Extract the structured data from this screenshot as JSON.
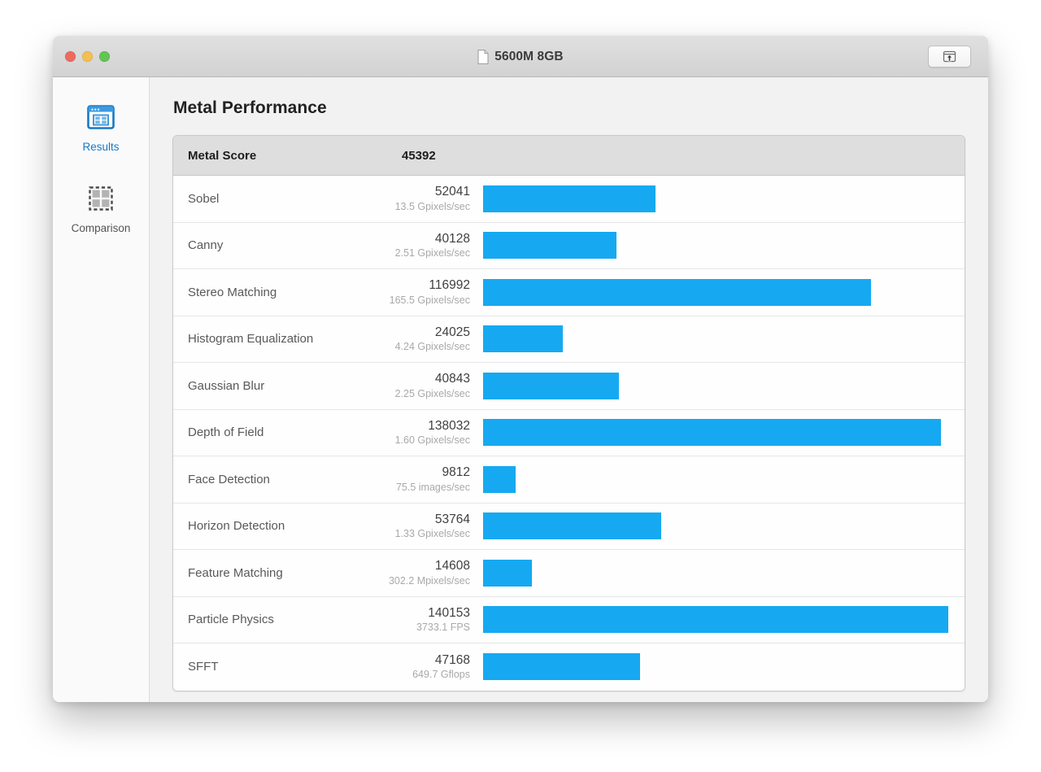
{
  "window": {
    "title": "5600M 8GB",
    "title_icon": "document-icon",
    "traffic_lights": [
      {
        "name": "close-button",
        "color": "#ed6a5e"
      },
      {
        "name": "minimize-button",
        "color": "#f5bf4f"
      },
      {
        "name": "zoom-button",
        "color": "#61c554"
      }
    ],
    "share_button_icon": "share-upload-icon"
  },
  "sidebar": {
    "items": [
      {
        "label": "Results",
        "icon": "results-window-grid-icon",
        "active": true
      },
      {
        "label": "Comparison",
        "icon": "comparison-dashed-grid-icon",
        "active": false
      }
    ]
  },
  "main": {
    "page_title": "Metal Performance",
    "accent_color": "#16a9f1",
    "header": {
      "name": "Metal Score",
      "score": "45392"
    }
  },
  "chart_data": {
    "type": "bar",
    "title": "Metal Performance",
    "xlabel": "",
    "ylabel": "",
    "grid": false,
    "legend": "none",
    "orientation": "horizontal",
    "bar_color": "#16a9f1",
    "overall_score_label": "Metal Score",
    "overall_score": 45392,
    "max_value": 140153,
    "categories": [
      "Sobel",
      "Canny",
      "Stereo Matching",
      "Histogram Equalization",
      "Gaussian Blur",
      "Depth of Field",
      "Face Detection",
      "Horizon Detection",
      "Feature Matching",
      "Particle Physics",
      "SFFT"
    ],
    "values": [
      52041,
      40128,
      116992,
      24025,
      40843,
      138032,
      9812,
      53764,
      14608,
      140153,
      47168
    ],
    "rates": [
      "13.5 Gpixels/sec",
      "2.51 Gpixels/sec",
      "165.5 Gpixels/sec",
      "4.24 Gpixels/sec",
      "2.25 Gpixels/sec",
      "1.60 Gpixels/sec",
      "75.5 images/sec",
      "1.33 Gpixels/sec",
      "302.2 Mpixels/sec",
      "3733.1 FPS",
      "649.7 Gflops"
    ],
    "rows": [
      {
        "name": "Sobel",
        "score": "52041",
        "rate": "13.5 Gpixels/sec",
        "value": 52041
      },
      {
        "name": "Canny",
        "score": "40128",
        "rate": "2.51 Gpixels/sec",
        "value": 40128
      },
      {
        "name": "Stereo Matching",
        "score": "116992",
        "rate": "165.5 Gpixels/sec",
        "value": 116992
      },
      {
        "name": "Histogram Equalization",
        "score": "24025",
        "rate": "4.24 Gpixels/sec",
        "value": 24025
      },
      {
        "name": "Gaussian Blur",
        "score": "40843",
        "rate": "2.25 Gpixels/sec",
        "value": 40843
      },
      {
        "name": "Depth of Field",
        "score": "138032",
        "rate": "1.60 Gpixels/sec",
        "value": 138032
      },
      {
        "name": "Face Detection",
        "score": "9812",
        "rate": "75.5 images/sec",
        "value": 9812
      },
      {
        "name": "Horizon Detection",
        "score": "53764",
        "rate": "1.33 Gpixels/sec",
        "value": 53764
      },
      {
        "name": "Feature Matching",
        "score": "14608",
        "rate": "302.2 Mpixels/sec",
        "value": 14608
      },
      {
        "name": "Particle Physics",
        "score": "140153",
        "rate": "3733.1 FPS",
        "value": 140153
      },
      {
        "name": "SFFT",
        "score": "47168",
        "rate": "649.7 Gflops",
        "value": 47168
      }
    ]
  }
}
